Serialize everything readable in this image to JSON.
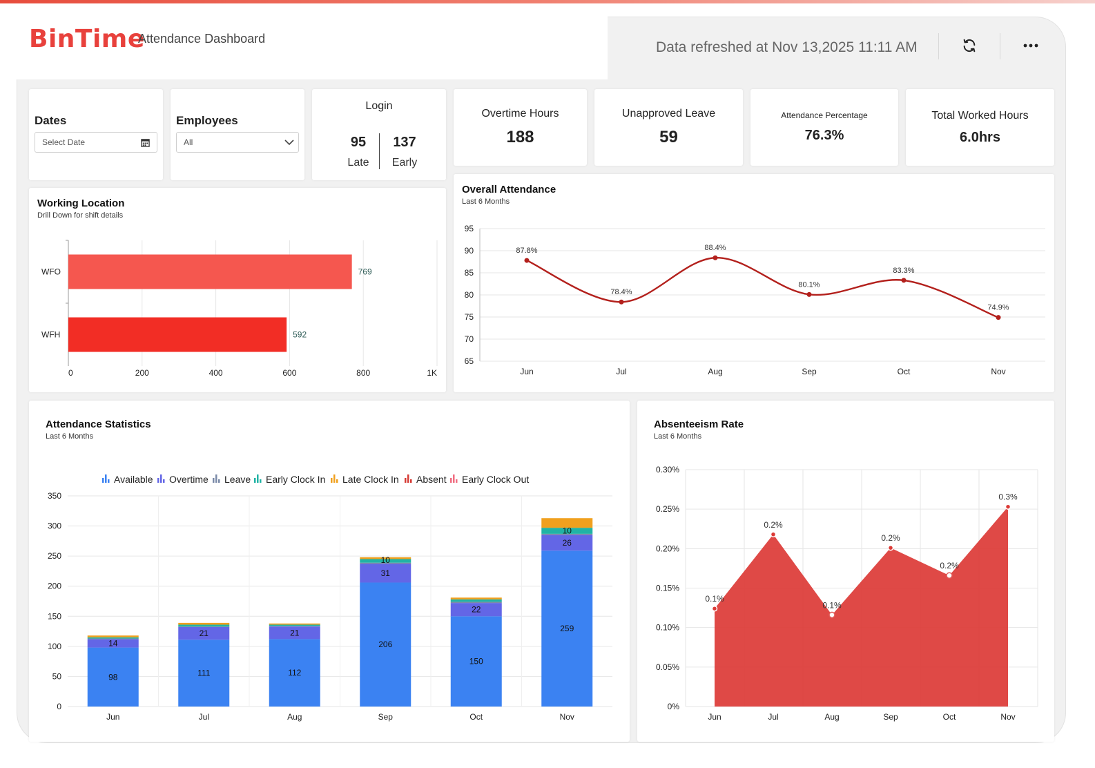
{
  "header": {
    "logo": "BinTime",
    "subtitle": "Attendance Dashboard",
    "refreshed": "Data refreshed at Nov 13,2025 11:11 AM"
  },
  "icons": {
    "refresh": "refresh-icon",
    "more": "more-icon",
    "calendar": "calendar-icon",
    "chevron": "chevron-down-icon"
  },
  "filters": {
    "dates_label": "Dates",
    "dates_placeholder": "Select Date",
    "employees_label": "Employees",
    "employees_value": "All"
  },
  "login": {
    "title": "Login",
    "late_value": "95",
    "late_label": "Late",
    "early_value": "137",
    "early_label": "Early"
  },
  "kpis": [
    {
      "title": "Overtime Hours",
      "value": "188"
    },
    {
      "title": "Unapproved Leave",
      "value": "59"
    },
    {
      "title": "Attendance Percentage",
      "value": "76.3%"
    },
    {
      "title": "Total Worked Hours",
      "value": "6.0hrs"
    }
  ],
  "chart_data": [
    {
      "id": "working-location",
      "type": "bar",
      "orientation": "horizontal",
      "title": "Working Location",
      "subtitle": "Drill Down for shift details",
      "categories": [
        "WFO",
        "WFH"
      ],
      "values": [
        769,
        592
      ],
      "xlim": [
        0,
        1000
      ],
      "xticks": [
        "0",
        "200",
        "400",
        "600",
        "800",
        "1K"
      ],
      "colors": [
        "#f5574f",
        "#f22d25"
      ]
    },
    {
      "id": "overall-attendance",
      "type": "line",
      "title": "Overall Attendance",
      "subtitle": "Last 6 Months",
      "categories": [
        "Jun",
        "Jul",
        "Aug",
        "Sep",
        "Oct",
        "Nov"
      ],
      "values": [
        87.8,
        78.4,
        88.4,
        80.1,
        83.3,
        74.9
      ],
      "labels": [
        "87.8%",
        "78.4%",
        "88.4%",
        "80.1%",
        "83.3%",
        "74.9%"
      ],
      "ylim": [
        65,
        95
      ],
      "yticks": [
        "65",
        "70",
        "75",
        "80",
        "85",
        "90",
        "95"
      ],
      "color": "#b3201c"
    },
    {
      "id": "attendance-statistics",
      "type": "bar",
      "stacked": true,
      "title": "Attendance Statistics",
      "subtitle": "Last 6 Months",
      "categories": [
        "Jun",
        "Jul",
        "Aug",
        "Sep",
        "Oct",
        "Nov"
      ],
      "ylim": [
        0,
        350
      ],
      "yticks": [
        "0",
        "50",
        "100",
        "150",
        "200",
        "250",
        "300",
        "350"
      ],
      "legend_position": "top",
      "series": [
        {
          "name": "Available",
          "color": "#3b82f2",
          "values": [
            98,
            111,
            112,
            206,
            150,
            259
          ],
          "labels": [
            "98",
            "111",
            "112",
            "206",
            "150",
            "259"
          ]
        },
        {
          "name": "Overtime",
          "color": "#6366e6",
          "values": [
            14,
            21,
            21,
            31,
            22,
            26
          ],
          "labels": [
            "14",
            "21",
            "21",
            "31",
            "22",
            "26"
          ]
        },
        {
          "name": "Leave",
          "color": "#7a8aa8",
          "values": [
            1,
            1,
            1,
            2,
            2,
            2
          ],
          "labels": [
            "",
            "",
            "",
            "",
            "",
            ""
          ]
        },
        {
          "name": "Early Clock In",
          "color": "#21b3a5",
          "values": [
            2,
            3,
            2,
            6,
            4,
            10
          ],
          "labels": [
            "",
            "",
            "",
            "",
            "",
            "10"
          ]
        },
        {
          "name": "Late Clock In",
          "color": "#f0a01e",
          "values": [
            3,
            3,
            2,
            3,
            3,
            16
          ],
          "labels": [
            "",
            "",
            "",
            "",
            "",
            ""
          ]
        },
        {
          "name": "Absent",
          "color": "#d63b34",
          "values": [
            0,
            0,
            0,
            0,
            0,
            0
          ],
          "labels": [
            "",
            "",
            "",
            "",
            "",
            ""
          ]
        },
        {
          "name": "Early Clock Out",
          "color": "#f06e82",
          "values": [
            0,
            0,
            0,
            0,
            0,
            0
          ],
          "labels": [
            "",
            "",
            "",
            "",
            "",
            ""
          ]
        }
      ],
      "extra_labels": {
        "sep_early_label": "10"
      }
    },
    {
      "id": "absenteeism-rate",
      "type": "area",
      "title": "Absenteeism Rate",
      "subtitle": "Last 6 Months",
      "categories": [
        "Jun",
        "Jul",
        "Aug",
        "Sep",
        "Oct",
        "Nov"
      ],
      "values": [
        0.124,
        0.218,
        0.116,
        0.201,
        0.166,
        0.253
      ],
      "labels": [
        "0.1%",
        "0.2%",
        "0.1%",
        "0.2%",
        "0.2%",
        "0.3%"
      ],
      "ylim": [
        0,
        0.3
      ],
      "yticks": [
        "0%",
        "0.05%",
        "0.10%",
        "0.15%",
        "0.20%",
        "0.25%",
        "0.30%"
      ],
      "color": "#dc3a36"
    }
  ]
}
